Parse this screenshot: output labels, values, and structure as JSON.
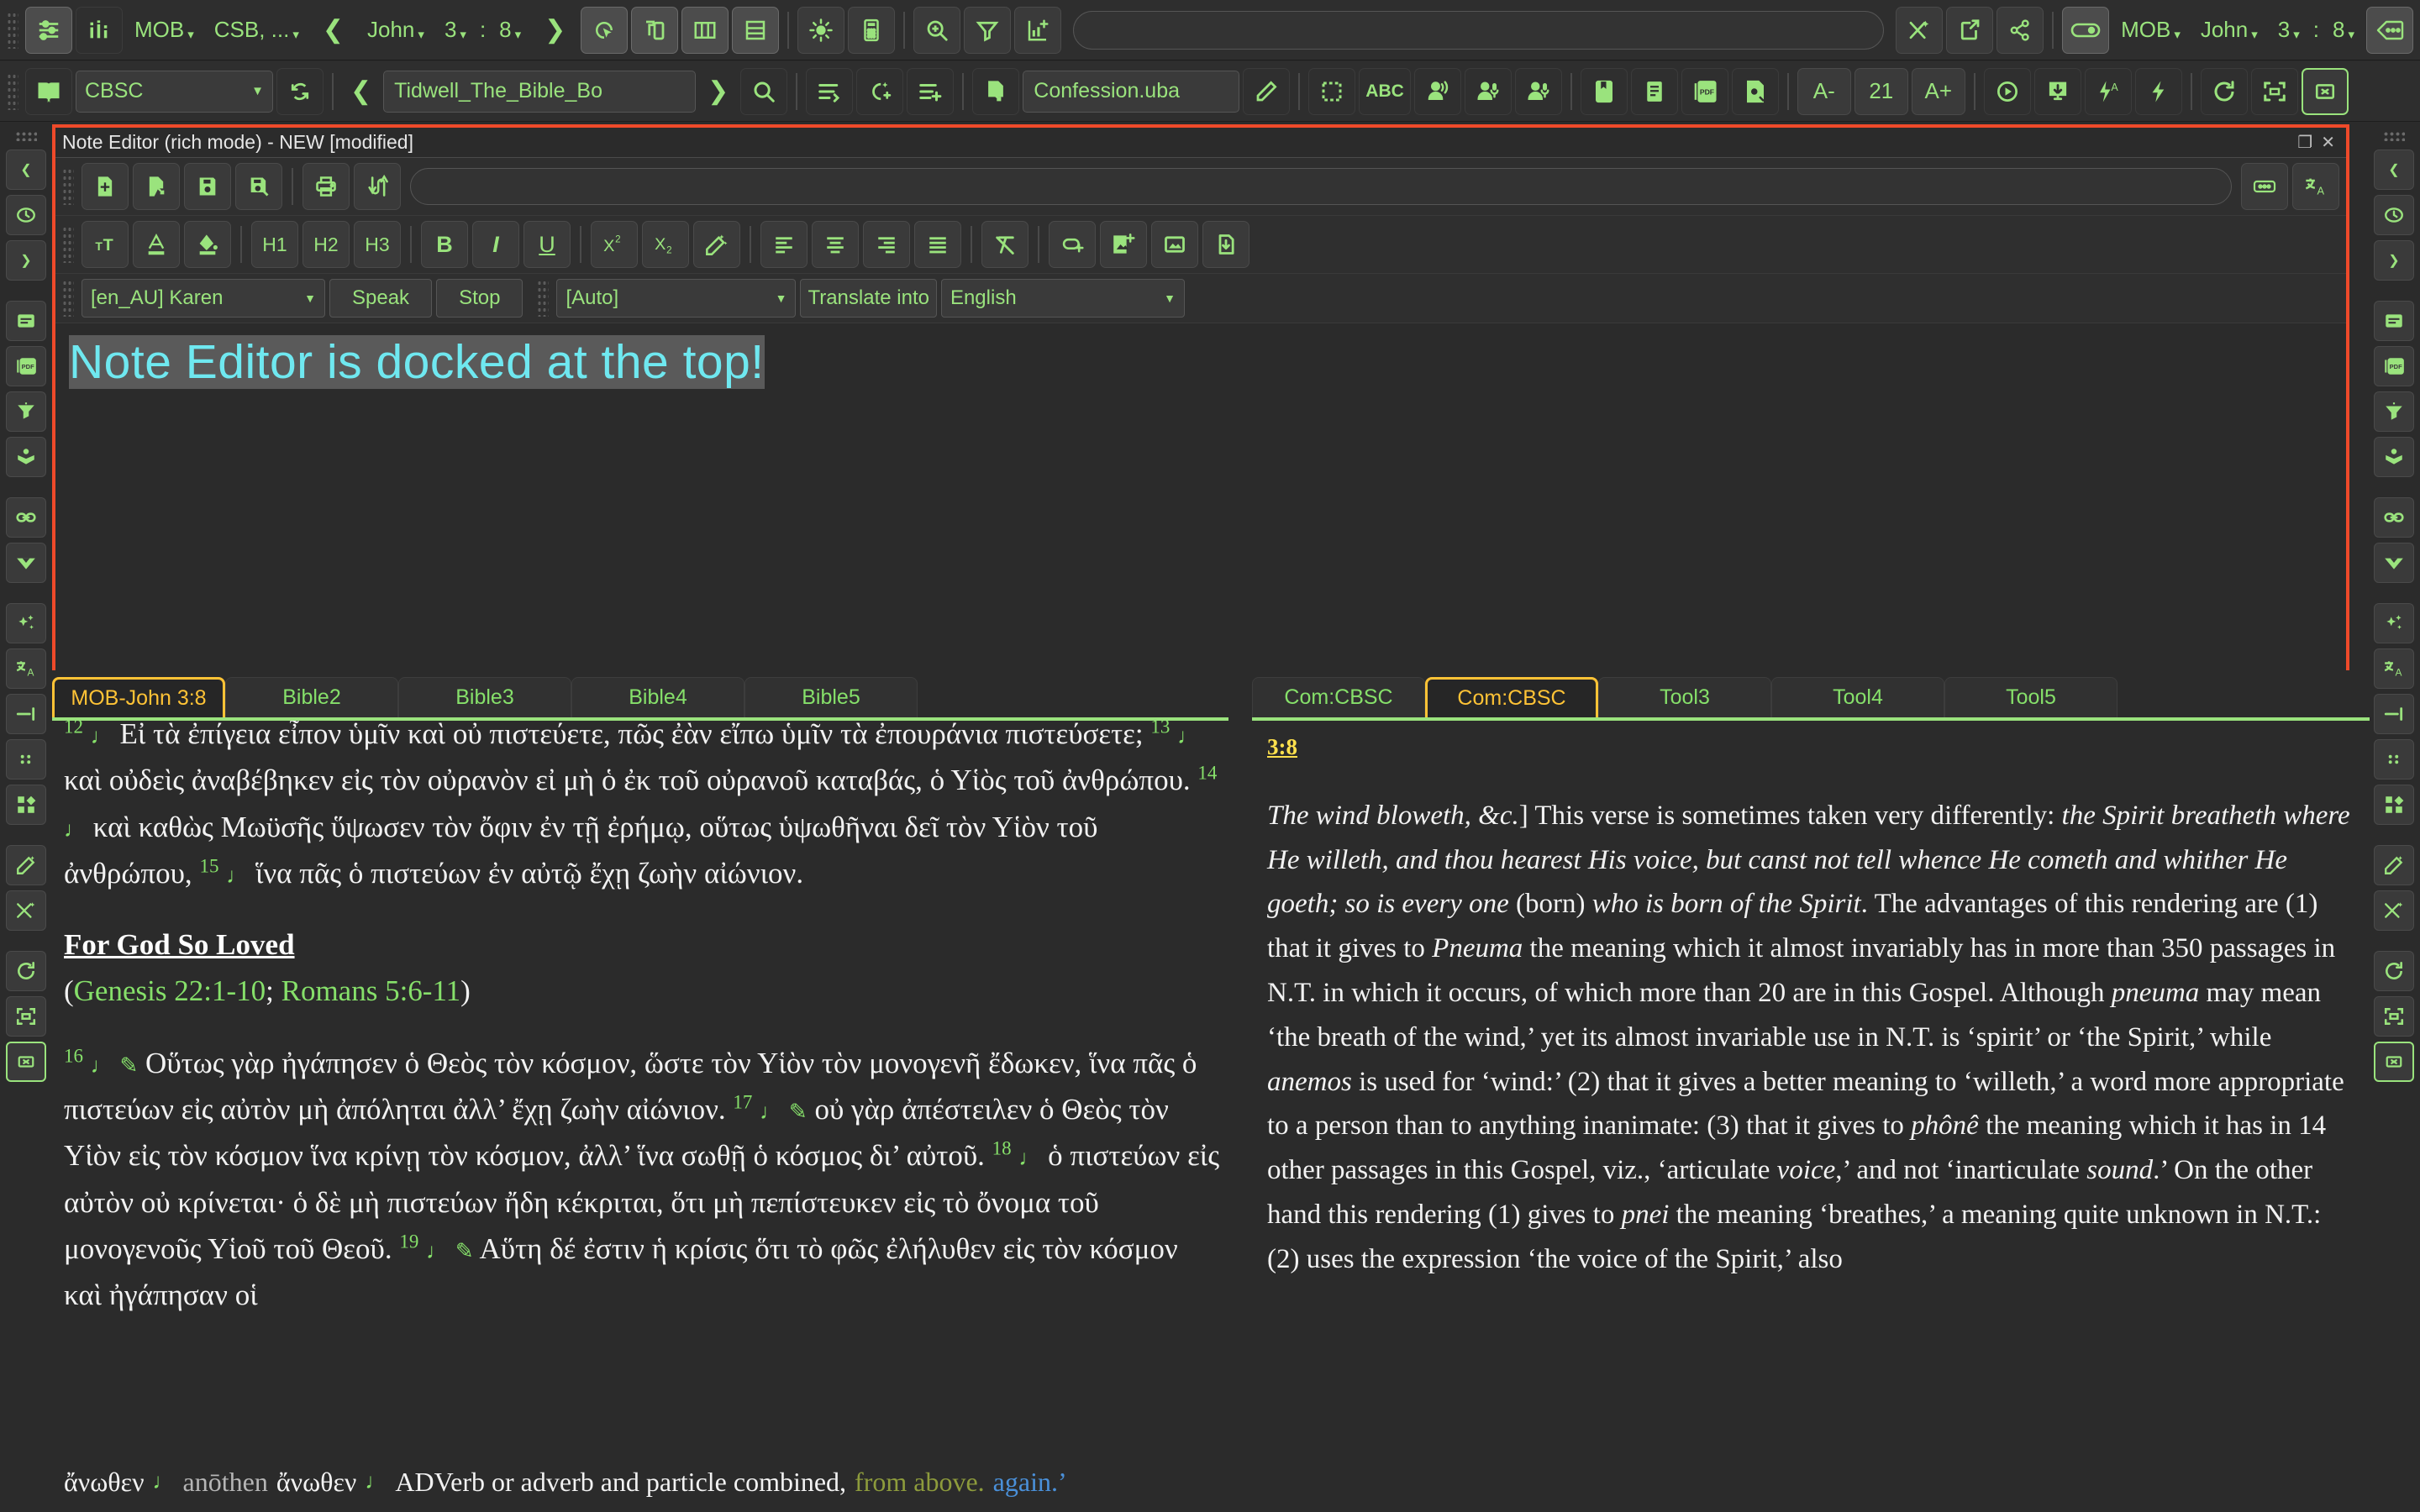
{
  "toolbar_top": {
    "controls_icon": "sliders-icon",
    "stats_icon": "bar-stats-icon",
    "bible_version": "MOB",
    "compare_versions": "CSB, ...",
    "prev_icon": "chevron-left-icon",
    "book": "John",
    "chapter": "3",
    "verse_sep": ":",
    "verse": "8",
    "next_icon": "chevron-right-icon",
    "icons": [
      "cursor-select-icon",
      "duplicate-window-icon",
      "columns-layout-icon",
      "rows-layout-icon",
      "brightness-icon",
      "calculator-icon",
      "zoom-search-icon",
      "filter-icon",
      "add-chart-icon"
    ],
    "search_placeholder": "",
    "right_icons": [
      "shuffle-star-icon",
      "external-link-icon",
      "share-icon"
    ],
    "toggle_icon": "toggle-switch-on-icon",
    "right_version": "MOB",
    "right_book": "John",
    "right_chapter": "3",
    "right_sep": ":",
    "right_verse": "8",
    "more_icon": "more-tag-icon"
  },
  "toolbar_second": {
    "book_icon": "open-book-icon",
    "resource": "CBSC",
    "refresh_icon": "refresh-icon",
    "prev_icon": "chevron-left-icon",
    "document": "Tidwell_The_Bible_Bo",
    "next_icon": "chevron-right-icon",
    "search_icon": "search-icon",
    "icons_a": [
      "list-go-icon",
      "sparkle-note-icon",
      "list-add-icon",
      "new-doc-icon"
    ],
    "filename": "Confession.uba",
    "edit_icon": "pencil-icon",
    "icons_b": [
      "select-region-icon",
      "abc-icon",
      "speak-icon",
      "read-aloud-icon",
      "mic-person-icon"
    ],
    "icons_c": [
      "bookmark-icon",
      "document-icon",
      "pdf-icon",
      "save-doc-icon"
    ],
    "font_decrease": "A-",
    "font_size": "21",
    "font_increase": "A+",
    "icons_d": [
      "play-icon",
      "download-icon",
      "flash-a-icon",
      "flash-icon"
    ],
    "icons_e": [
      "reload-icon",
      "fullscreen-icon",
      "close-icon"
    ]
  },
  "note_editor": {
    "title": "Note Editor (rich mode) - NEW [modified]",
    "window_restore_icon": "restore-window-icon",
    "window_close_icon": "close-window-icon",
    "file_icons": [
      "new-note-icon",
      "open-note-icon",
      "save-note-icon",
      "save-as-note-icon",
      "print-icon",
      "swap-mode-icon"
    ],
    "name_placeholder": "",
    "right_icons": [
      "insert-placeholder-icon",
      "translate-icon"
    ],
    "format_icons": [
      "font-size-icon",
      "text-color-icon",
      "fill-color-icon"
    ],
    "headings": [
      "H1",
      "H2",
      "H3"
    ],
    "styles": [
      "B",
      "I",
      "U"
    ],
    "script_icons": [
      "superscript-icon",
      "subscript-icon",
      "magic-format-icon"
    ],
    "align_icons": [
      "align-left-icon",
      "align-center-icon",
      "align-right-icon",
      "align-justify-icon"
    ],
    "misc_icons": [
      "clear-format-icon",
      "insert-link-icon",
      "insert-image-icon",
      "image-icon",
      "save-image-icon"
    ],
    "tts_voice": "[en_AU] Karen",
    "speak_label": "Speak",
    "stop_label": "Stop",
    "source_lang": "[Auto]",
    "translate_label": "Translate into",
    "target_lang": "English",
    "content": "Note Editor is docked at the top!"
  },
  "left_rail": {
    "items": [
      "chevron-left-icon",
      "history-icon",
      "chevron-right-icon",
      "document-icon",
      "pdf-icon",
      "parallel-icon",
      "import-icon",
      "compare-icon",
      "link-icon",
      "bookmark-diamond-icon",
      "sparkle-icon",
      "translate-icon",
      "outline-icon",
      "dots-icon",
      "layout-icon",
      "pencil-star-icon",
      "shuffle-star-icon",
      "reload-icon",
      "fullscreen-icon",
      "close-icon"
    ]
  },
  "right_rail": {
    "items": [
      "chevron-left-icon",
      "history-icon",
      "chevron-right-icon",
      "document-icon",
      "pdf-icon",
      "funnel-icon",
      "read-icon",
      "link-icon",
      "diamond-icon",
      "sparkle-icon",
      "translate-icon",
      "outline-icon",
      "dots-icon",
      "layout-icon",
      "pencil-star-icon",
      "shuffle-star-icon",
      "reload-icon",
      "fullscreen-icon",
      "close-icon"
    ]
  },
  "bible_tabs": [
    {
      "label": "MOB-John 3:8",
      "active": true
    },
    {
      "label": "Bible2",
      "active": false
    },
    {
      "label": "Bible3",
      "active": false
    },
    {
      "label": "Bible4",
      "active": false
    },
    {
      "label": "Bible5",
      "active": false
    }
  ],
  "tool_tabs": [
    {
      "label": "Com:CBSC",
      "active": false
    },
    {
      "label": "Com:CBSC",
      "active": true
    },
    {
      "label": "Tool3",
      "active": false
    },
    {
      "label": "Tool4",
      "active": false
    },
    {
      "label": "Tool5",
      "active": false
    }
  ],
  "bible_pane": {
    "verses": [
      {
        "num": "12",
        "text": "Εἰ τὰ ἐπίγεια εἶπον ὑμῖν καὶ οὐ πιστεύετε, πῶς ἐὰν εἴπω ὑμῖν τὰ ἐπουράνια πιστεύσετε;"
      },
      {
        "num": "13",
        "text": "καὶ οὐδεὶς ἀναβέβηκεν εἰς τὸν οὐρανὸν εἰ μὴ ὁ ἐκ τοῦ οὐρανοῦ καταβάς, ὁ Υἱὸς τοῦ ἀνθρώπου."
      },
      {
        "num": "14",
        "text": "καὶ καθὼς Μωϋσῆς ὕψωσεν τὸν ὄφιν ἐν τῇ ἐρήμῳ, οὕτως ὑψωθῆναι δεῖ τὸν Υἱὸν τοῦ ἀνθρώπου,"
      },
      {
        "num": "15",
        "text": "ἵνα πᾶς ὁ πιστεύων ἐν αὐτῷ ἔχῃ ζωὴν αἰώνιον."
      }
    ],
    "heading": "For God So Loved",
    "heading_refs_open": "(",
    "heading_ref1": "Genesis 22:1-10",
    "heading_ref_sep": "; ",
    "heading_ref2": "Romans 5:6-11",
    "heading_refs_close": ")",
    "verses2": [
      {
        "num": "16",
        "text": "Οὕτως γὰρ ἠγάπησεν ὁ Θεὸς τὸν κόσμον, ὥστε τὸν Υἱὸν τὸν μονογενῆ ἔδωκεν, ἵνα πᾶς ὁ πιστεύων εἰς αὐτὸν μὴ ἀπόληται ἀλλ’ ἔχῃ ζωὴν αἰώνιον."
      },
      {
        "num": "17",
        "text": "οὐ γὰρ ἀπέστειλεν ὁ Θεὸς τὸν Υἱὸν εἰς τὸν κόσμον ἵνα κρίνῃ τὸν κόσμον, ἀλλ’ ἵνα σωθῇ ὁ κόσμος δι’ αὐτοῦ."
      },
      {
        "num": "18",
        "text": "ὁ πιστεύων εἰς αὐτὸν οὐ κρίνεται· ὁ δὲ μὴ πιστεύων ἤδη κέκριται, ὅτι μὴ πεπίστευκεν εἰς τὸ ὄνομα τοῦ μονογενοῦς Υἱοῦ τοῦ Θεοῦ."
      },
      {
        "num": "19",
        "text": "Αὕτη δέ ἐστιν ἡ κρίσις ὅτι τὸ φῶς ἐλήλυθεν εἰς τὸν κόσμον καὶ ἠγάπησαν οἱ"
      }
    ]
  },
  "commentary_pane": {
    "verse_ref": "3:8",
    "paragraph_html": "<i>The wind bloweth, &amp;c.</i>] This verse is sometimes taken very differently: <i>the Spirit breatheth where He willeth, and thou hearest His voice, but canst not tell whence He cometh and whither He goeth; so is every one</i> (born) <i>who is born of the Spirit</i>. The advantages of this rendering are (1) that it gives to <i>Pneuma</i> the meaning which it almost invariably has in more than 350 passages in N.T. in which it occurs, of which more than 20 are in this Gospel. Although <i>pneuma</i> may mean ‘the breath of the wind,’ yet its almost invariable use in N.T. is ‘spirit’ or ‘the Spirit,’ while <i>anemos</i> is used for ‘wind:’ (2) that it gives a better meaning to ‘willeth,’ a word more appropriate to a person than to anything inanimate: (3) that it gives to <i>phônê</i> the meaning which it has in 14 other passages in this Gospel, viz., ‘articulate <i>voice</i>,’ and not ‘inarticulate <i>sound</i>.’ On the other hand this rendering (1) gives to <i>pnei</i> the meaning ‘breathes,’ a meaning quite unknown in N.T.: (2) uses the expression ‘the voice of the Spirit,’ also"
  },
  "status_bar": {
    "greek": "ἄνωθεν",
    "note_icon": "note-icon",
    "transliteration": "anōthen",
    "greek2": "ἄνωθεν",
    "note_icon2": "note-icon",
    "gloss": "ADVerb or adverb and particle combined,",
    "meaning1": "from above.",
    "meaning2": "again.’"
  },
  "colors": {
    "accent_green": "#9ae37d",
    "active_tab": "#ffc336",
    "panel_border": "#ef4a2a",
    "note_text": "#6fe8f0",
    "bg": "#2b2b2b"
  }
}
